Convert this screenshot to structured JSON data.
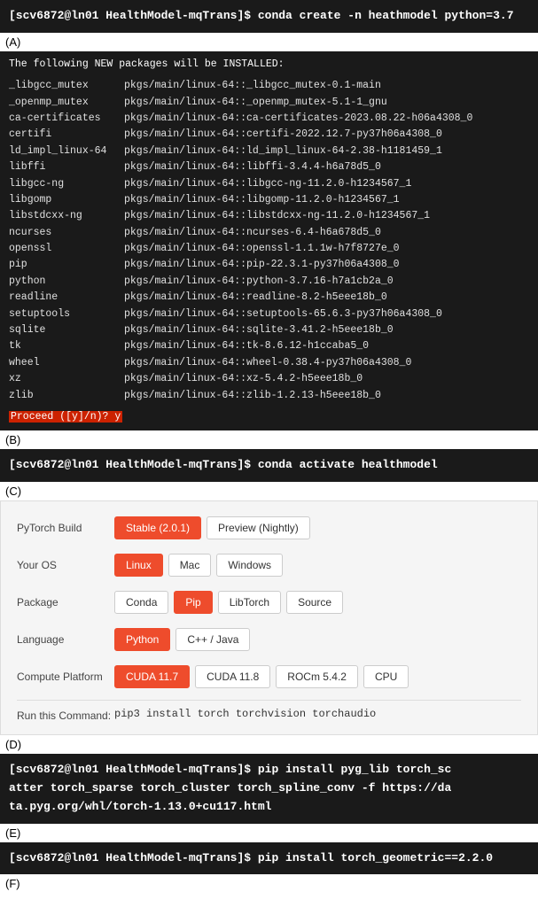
{
  "sections": {
    "A": {
      "label": "(A)",
      "terminal_prompt": "[scv6872@ln01 HealthModel-mqTrans]$ conda create -n heathmodel python=3.7"
    },
    "packages": {
      "header": "The following NEW packages will be INSTALLED:",
      "items": [
        {
          "name": "_libgcc_mutex",
          "path": "pkgs/main/linux-64::_libgcc_mutex-0.1-main"
        },
        {
          "name": "_openmp_mutex",
          "path": "pkgs/main/linux-64::_openmp_mutex-5.1-1_gnu"
        },
        {
          "name": "ca-certificates",
          "path": "pkgs/main/linux-64::ca-certificates-2023.08.22-h06a4308_0"
        },
        {
          "name": "certifi",
          "path": "pkgs/main/linux-64::certifi-2022.12.7-py37h06a4308_0"
        },
        {
          "name": "ld_impl_linux-64",
          "path": "pkgs/main/linux-64::ld_impl_linux-64-2.38-h1181459_1"
        },
        {
          "name": "libffi",
          "path": "pkgs/main/linux-64::libffi-3.4.4-h6a78d5_0"
        },
        {
          "name": "libgcc-ng",
          "path": "pkgs/main/linux-64::libgcc-ng-11.2.0-h1234567_1"
        },
        {
          "name": "libgomp",
          "path": "pkgs/main/linux-64::libgomp-11.2.0-h1234567_1"
        },
        {
          "name": "libstdcxx-ng",
          "path": "pkgs/main/linux-64::libstdcxx-ng-11.2.0-h1234567_1"
        },
        {
          "name": "ncurses",
          "path": "pkgs/main/linux-64::ncurses-6.4-h6a678d5_0"
        },
        {
          "name": "openssl",
          "path": "pkgs/main/linux-64::openssl-1.1.1w-h7f8727e_0"
        },
        {
          "name": "pip",
          "path": "pkgs/main/linux-64::pip-22.3.1-py37h06a4308_0"
        },
        {
          "name": "python",
          "path": "pkgs/main/linux-64::python-3.7.16-h7a1cb2a_0"
        },
        {
          "name": "readline",
          "path": "pkgs/main/linux-64::readline-8.2-h5eee18b_0"
        },
        {
          "name": "setuptools",
          "path": "pkgs/main/linux-64::setuptools-65.6.3-py37h06a4308_0"
        },
        {
          "name": "sqlite",
          "path": "pkgs/main/linux-64::sqlite-3.41.2-h5eee18b_0"
        },
        {
          "name": "tk",
          "path": "pkgs/main/linux-64::tk-8.6.12-h1ccaba5_0"
        },
        {
          "name": "wheel",
          "path": "pkgs/main/linux-64::wheel-0.38.4-py37h06a4308_0"
        },
        {
          "name": "xz",
          "path": "pkgs/main/linux-64::xz-5.4.2-h5eee18b_0"
        },
        {
          "name": "zlib",
          "path": "pkgs/main/linux-64::zlib-1.2.13-h5eee18b_0"
        }
      ],
      "proceed_text": "Proceed ([y]/n)? y"
    },
    "B": {
      "label": "(B)",
      "terminal_prompt": "[scv6872@ln01 HealthModel-mqTrans]$ conda activate healthmodel"
    },
    "C": {
      "label": "(C)",
      "pytorch": {
        "rows": [
          {
            "label": "PyTorch Build",
            "options": [
              {
                "text": "Stable (2.0.1)",
                "selected": true
              },
              {
                "text": "Preview (Nightly)",
                "selected": false
              }
            ]
          },
          {
            "label": "Your OS",
            "options": [
              {
                "text": "Linux",
                "selected": true
              },
              {
                "text": "Mac",
                "selected": false
              },
              {
                "text": "Windows",
                "selected": false
              }
            ]
          },
          {
            "label": "Package",
            "options": [
              {
                "text": "Conda",
                "selected": false
              },
              {
                "text": "Pip",
                "selected": true
              },
              {
                "text": "LibTorch",
                "selected": false
              },
              {
                "text": "Source",
                "selected": false
              }
            ]
          },
          {
            "label": "Language",
            "options": [
              {
                "text": "Python",
                "selected": true
              },
              {
                "text": "C++ / Java",
                "selected": false
              }
            ]
          },
          {
            "label": "Compute Platform",
            "options": [
              {
                "text": "CUDA 11.7",
                "selected": true
              },
              {
                "text": "CUDA 11.8",
                "selected": false
              },
              {
                "text": "ROCm 5.4.2",
                "selected": false
              },
              {
                "text": "CPU",
                "selected": false
              }
            ]
          }
        ],
        "run_command_label": "Run this Command:",
        "run_command_value": "pip3 install torch torchvision torchaudio"
      }
    },
    "D": {
      "label": "(D)",
      "terminal_text": "[scv6872@ln01 HealthModel-mqTrans]$ pip install pyg_lib torch_sc\natter torch_sparse torch_cluster torch_spline_conv -f https://da\nta.pyg.org/whl/torch-1.13.0+cu117.html"
    },
    "E": {
      "label": "(E)",
      "terminal_text": "[scv6872@ln01 HealthModel-mqTrans]$ pip install torch_geometric==2.2.0"
    },
    "F": {
      "label": "(F)"
    }
  },
  "colors": {
    "selected_btn": "#ee4c2c",
    "terminal_bg": "#1a1a1a",
    "proceed_highlight": "#cc2200"
  }
}
